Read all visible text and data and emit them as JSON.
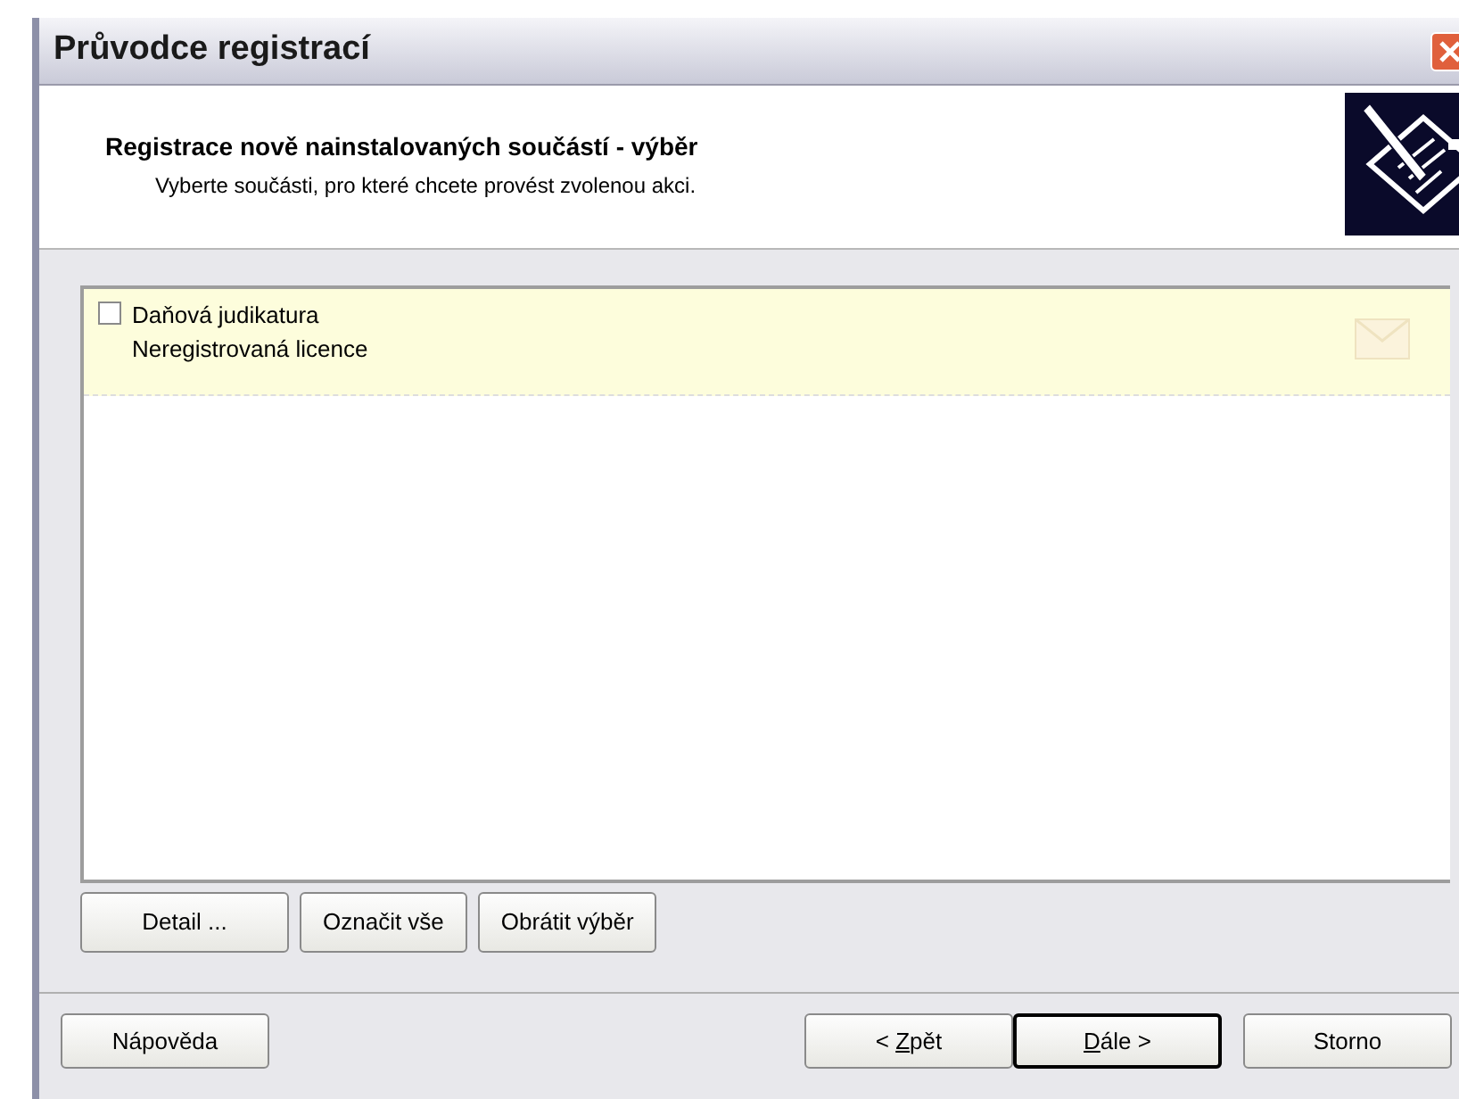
{
  "window": {
    "title": "Průvodce registrací"
  },
  "header": {
    "title": "Registrace nově nainstalovaných součástí - výběr",
    "subtitle": "Vyberte součásti, pro které chcete provést zvolenou akci."
  },
  "components": [
    {
      "name": "Daňová judikatura",
      "status": "Neregistrovaná licence",
      "checked": false,
      "selected": true
    }
  ],
  "list_buttons": [
    {
      "label": "Detail ..."
    },
    {
      "label": "Označit vše"
    },
    {
      "label": "Obrátit výběr"
    }
  ],
  "footer_buttons": [
    {
      "before": "Nápověda",
      "default": false
    },
    {
      "before": "< ",
      "key": "Z",
      "after": "pět",
      "default": false
    },
    {
      "key": "D",
      "after": "ále >",
      "default": true
    },
    {
      "before": "Storno",
      "default": false
    }
  ]
}
